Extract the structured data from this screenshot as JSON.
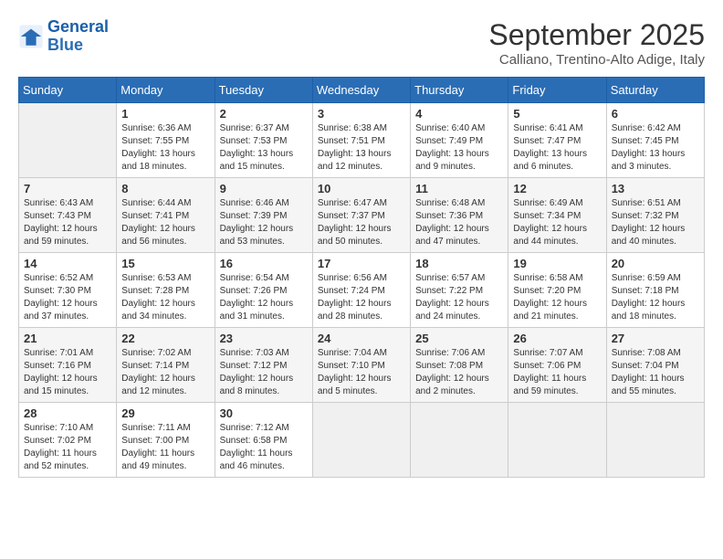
{
  "header": {
    "logo_line1": "General",
    "logo_line2": "Blue",
    "month": "September 2025",
    "location": "Calliano, Trentino-Alto Adige, Italy"
  },
  "days_of_week": [
    "Sunday",
    "Monday",
    "Tuesday",
    "Wednesday",
    "Thursday",
    "Friday",
    "Saturday"
  ],
  "weeks": [
    [
      {
        "day": "",
        "info": ""
      },
      {
        "day": "1",
        "info": "Sunrise: 6:36 AM\nSunset: 7:55 PM\nDaylight: 13 hours\nand 18 minutes."
      },
      {
        "day": "2",
        "info": "Sunrise: 6:37 AM\nSunset: 7:53 PM\nDaylight: 13 hours\nand 15 minutes."
      },
      {
        "day": "3",
        "info": "Sunrise: 6:38 AM\nSunset: 7:51 PM\nDaylight: 13 hours\nand 12 minutes."
      },
      {
        "day": "4",
        "info": "Sunrise: 6:40 AM\nSunset: 7:49 PM\nDaylight: 13 hours\nand 9 minutes."
      },
      {
        "day": "5",
        "info": "Sunrise: 6:41 AM\nSunset: 7:47 PM\nDaylight: 13 hours\nand 6 minutes."
      },
      {
        "day": "6",
        "info": "Sunrise: 6:42 AM\nSunset: 7:45 PM\nDaylight: 13 hours\nand 3 minutes."
      }
    ],
    [
      {
        "day": "7",
        "info": "Sunrise: 6:43 AM\nSunset: 7:43 PM\nDaylight: 12 hours\nand 59 minutes."
      },
      {
        "day": "8",
        "info": "Sunrise: 6:44 AM\nSunset: 7:41 PM\nDaylight: 12 hours\nand 56 minutes."
      },
      {
        "day": "9",
        "info": "Sunrise: 6:46 AM\nSunset: 7:39 PM\nDaylight: 12 hours\nand 53 minutes."
      },
      {
        "day": "10",
        "info": "Sunrise: 6:47 AM\nSunset: 7:37 PM\nDaylight: 12 hours\nand 50 minutes."
      },
      {
        "day": "11",
        "info": "Sunrise: 6:48 AM\nSunset: 7:36 PM\nDaylight: 12 hours\nand 47 minutes."
      },
      {
        "day": "12",
        "info": "Sunrise: 6:49 AM\nSunset: 7:34 PM\nDaylight: 12 hours\nand 44 minutes."
      },
      {
        "day": "13",
        "info": "Sunrise: 6:51 AM\nSunset: 7:32 PM\nDaylight: 12 hours\nand 40 minutes."
      }
    ],
    [
      {
        "day": "14",
        "info": "Sunrise: 6:52 AM\nSunset: 7:30 PM\nDaylight: 12 hours\nand 37 minutes."
      },
      {
        "day": "15",
        "info": "Sunrise: 6:53 AM\nSunset: 7:28 PM\nDaylight: 12 hours\nand 34 minutes."
      },
      {
        "day": "16",
        "info": "Sunrise: 6:54 AM\nSunset: 7:26 PM\nDaylight: 12 hours\nand 31 minutes."
      },
      {
        "day": "17",
        "info": "Sunrise: 6:56 AM\nSunset: 7:24 PM\nDaylight: 12 hours\nand 28 minutes."
      },
      {
        "day": "18",
        "info": "Sunrise: 6:57 AM\nSunset: 7:22 PM\nDaylight: 12 hours\nand 24 minutes."
      },
      {
        "day": "19",
        "info": "Sunrise: 6:58 AM\nSunset: 7:20 PM\nDaylight: 12 hours\nand 21 minutes."
      },
      {
        "day": "20",
        "info": "Sunrise: 6:59 AM\nSunset: 7:18 PM\nDaylight: 12 hours\nand 18 minutes."
      }
    ],
    [
      {
        "day": "21",
        "info": "Sunrise: 7:01 AM\nSunset: 7:16 PM\nDaylight: 12 hours\nand 15 minutes."
      },
      {
        "day": "22",
        "info": "Sunrise: 7:02 AM\nSunset: 7:14 PM\nDaylight: 12 hours\nand 12 minutes."
      },
      {
        "day": "23",
        "info": "Sunrise: 7:03 AM\nSunset: 7:12 PM\nDaylight: 12 hours\nand 8 minutes."
      },
      {
        "day": "24",
        "info": "Sunrise: 7:04 AM\nSunset: 7:10 PM\nDaylight: 12 hours\nand 5 minutes."
      },
      {
        "day": "25",
        "info": "Sunrise: 7:06 AM\nSunset: 7:08 PM\nDaylight: 12 hours\nand 2 minutes."
      },
      {
        "day": "26",
        "info": "Sunrise: 7:07 AM\nSunset: 7:06 PM\nDaylight: 11 hours\nand 59 minutes."
      },
      {
        "day": "27",
        "info": "Sunrise: 7:08 AM\nSunset: 7:04 PM\nDaylight: 11 hours\nand 55 minutes."
      }
    ],
    [
      {
        "day": "28",
        "info": "Sunrise: 7:10 AM\nSunset: 7:02 PM\nDaylight: 11 hours\nand 52 minutes."
      },
      {
        "day": "29",
        "info": "Sunrise: 7:11 AM\nSunset: 7:00 PM\nDaylight: 11 hours\nand 49 minutes."
      },
      {
        "day": "30",
        "info": "Sunrise: 7:12 AM\nSunset: 6:58 PM\nDaylight: 11 hours\nand 46 minutes."
      },
      {
        "day": "",
        "info": ""
      },
      {
        "day": "",
        "info": ""
      },
      {
        "day": "",
        "info": ""
      },
      {
        "day": "",
        "info": ""
      }
    ]
  ]
}
